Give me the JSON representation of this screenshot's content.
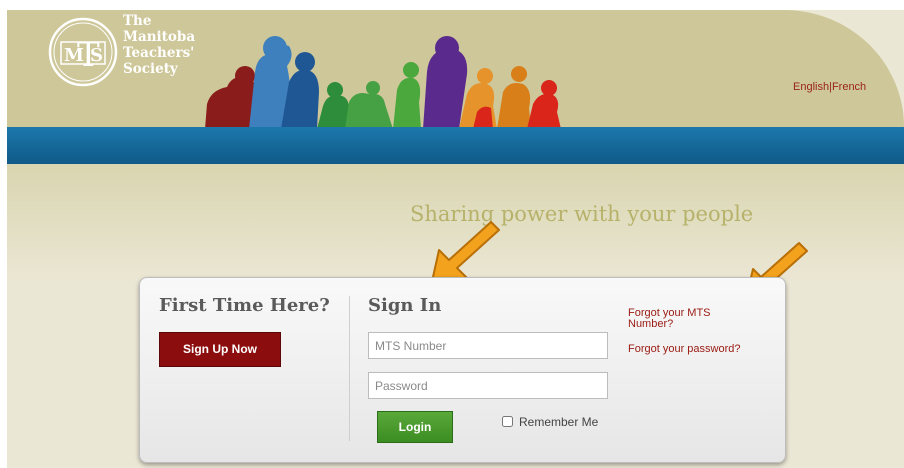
{
  "logo": {
    "monogram_left": "M",
    "monogram_mid": "T",
    "monogram_right": "S",
    "lines": [
      "The",
      "Manitoba",
      "Teachers'",
      "Society"
    ]
  },
  "lang": {
    "english": "English",
    "separator": "|",
    "french": "French"
  },
  "tagline": "Sharing power with your people",
  "first_time": {
    "title": "First Time Here?",
    "signup_label": "Sign Up Now"
  },
  "sign_in": {
    "title": "Sign In",
    "mts_placeholder": "MTS Number",
    "password_placeholder": "Password",
    "login_label": "Login",
    "remember_label": "Remember Me"
  },
  "forgot": {
    "mts_line1": "Forgot your MTS",
    "mts_line2": "Number?",
    "password": "Forgot your password?"
  },
  "colors": {
    "header": "#cec799",
    "band": "#1d78ab",
    "background": "#ebe7d5",
    "signup": "#8c0d0d",
    "login": "#4a9b2e",
    "link": "#9a1a12",
    "tagline": "#b7b26a",
    "arrow": "#f2a21c"
  }
}
